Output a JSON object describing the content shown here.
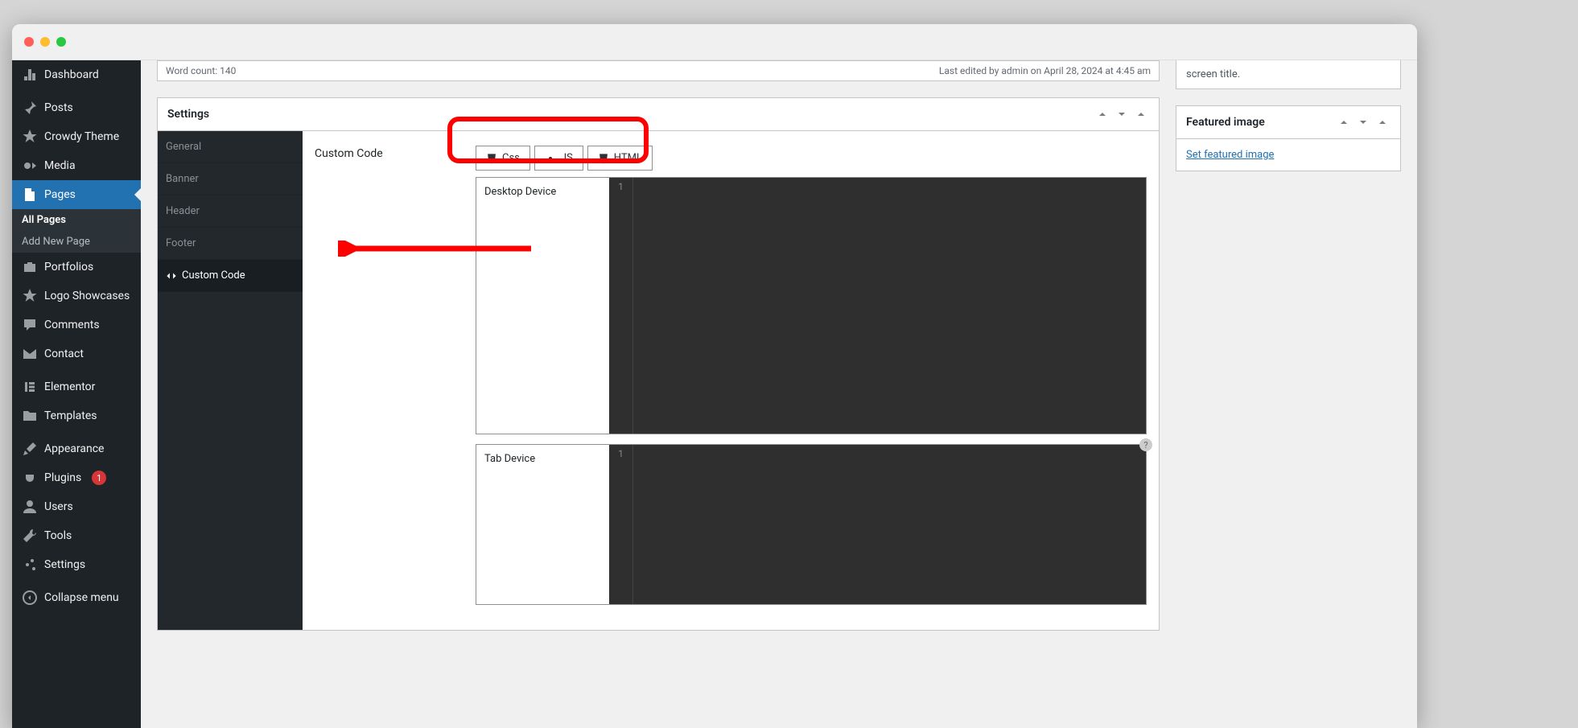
{
  "statusbar": {
    "word_count_label": "Word count: 140",
    "last_edited": "Last edited by admin on April 28, 2024 at 4:45 am"
  },
  "sidebar": {
    "items": [
      {
        "label": "Dashboard",
        "icon": "dashboard"
      },
      {
        "label": "Posts",
        "icon": "pin"
      },
      {
        "label": "Crowdy Theme",
        "icon": "star"
      },
      {
        "label": "Media",
        "icon": "media"
      },
      {
        "label": "Pages",
        "icon": "page",
        "active": true
      },
      {
        "label": "Portfolios",
        "icon": "portfolio"
      },
      {
        "label": "Logo Showcases",
        "icon": "star"
      },
      {
        "label": "Comments",
        "icon": "comment"
      },
      {
        "label": "Contact",
        "icon": "mail"
      },
      {
        "label": "Elementor",
        "icon": "elementor"
      },
      {
        "label": "Templates",
        "icon": "folder"
      },
      {
        "label": "Appearance",
        "icon": "brush"
      },
      {
        "label": "Plugins",
        "icon": "plug",
        "badge": "1"
      },
      {
        "label": "Users",
        "icon": "user"
      },
      {
        "label": "Tools",
        "icon": "wrench"
      },
      {
        "label": "Settings",
        "icon": "sliders"
      },
      {
        "label": "Collapse menu",
        "icon": "collapse"
      }
    ],
    "submenu": [
      {
        "label": "All Pages",
        "active": true
      },
      {
        "label": "Add New Page"
      }
    ]
  },
  "settings_panel": {
    "title": "Settings",
    "nav": [
      {
        "label": "General"
      },
      {
        "label": "Banner"
      },
      {
        "label": "Header"
      },
      {
        "label": "Footer"
      },
      {
        "label": "Custom Code",
        "active": true,
        "icon": "code"
      }
    ],
    "section_label": "Custom Code",
    "code_tabs": [
      {
        "label": "Css",
        "icon": "css"
      },
      {
        "label": "JS",
        "icon": "gear"
      },
      {
        "label": "HTML",
        "icon": "html"
      }
    ],
    "devices": [
      {
        "label": "Desktop Device",
        "line": "1"
      },
      {
        "label": "Tab Device",
        "line": "1"
      }
    ]
  },
  "side_panels": {
    "partial_text": "screen title.",
    "featured": {
      "title": "Featured image",
      "link": "Set featured image"
    }
  }
}
